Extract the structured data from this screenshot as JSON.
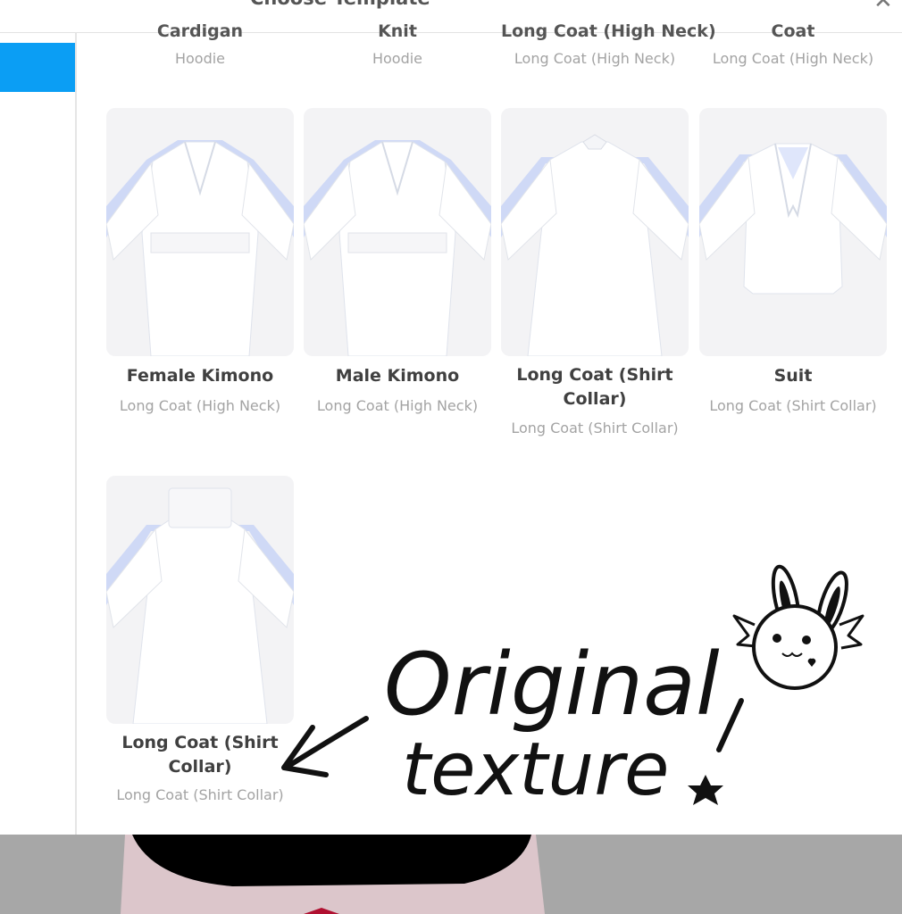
{
  "dialog": {
    "title": "Choose Template",
    "close_icon": "close-icon"
  },
  "top_row": [
    {
      "title": "Cardigan",
      "subtitle": "Hoodie"
    },
    {
      "title": "Knit",
      "subtitle": "Hoodie"
    },
    {
      "title": "Long Coat (High Neck)",
      "subtitle": "Long Coat (High Neck)"
    },
    {
      "title": "Coat",
      "subtitle": "Long Coat (High Neck)"
    }
  ],
  "templates": [
    {
      "title": "Female Kimono",
      "subtitle": "Long Coat (High Neck)"
    },
    {
      "title": "Male Kimono",
      "subtitle": "Long Coat (High Neck)"
    },
    {
      "title": "Long Coat (Shirt Collar)",
      "subtitle": "Long Coat (Shirt Collar)"
    },
    {
      "title": "Suit",
      "subtitle": "Long Coat (Shirt Collar)"
    },
    {
      "title": "Long Coat (Shirt Collar)",
      "subtitle": "Long Coat (Shirt Collar)"
    }
  ],
  "annotation": {
    "line1": "Original",
    "line2": "texture",
    "mark": "!"
  },
  "colors": {
    "accent": "#0b9ef4",
    "thumb_bg": "#f3f3f5",
    "bottom_bg": "#a7a7a7"
  }
}
